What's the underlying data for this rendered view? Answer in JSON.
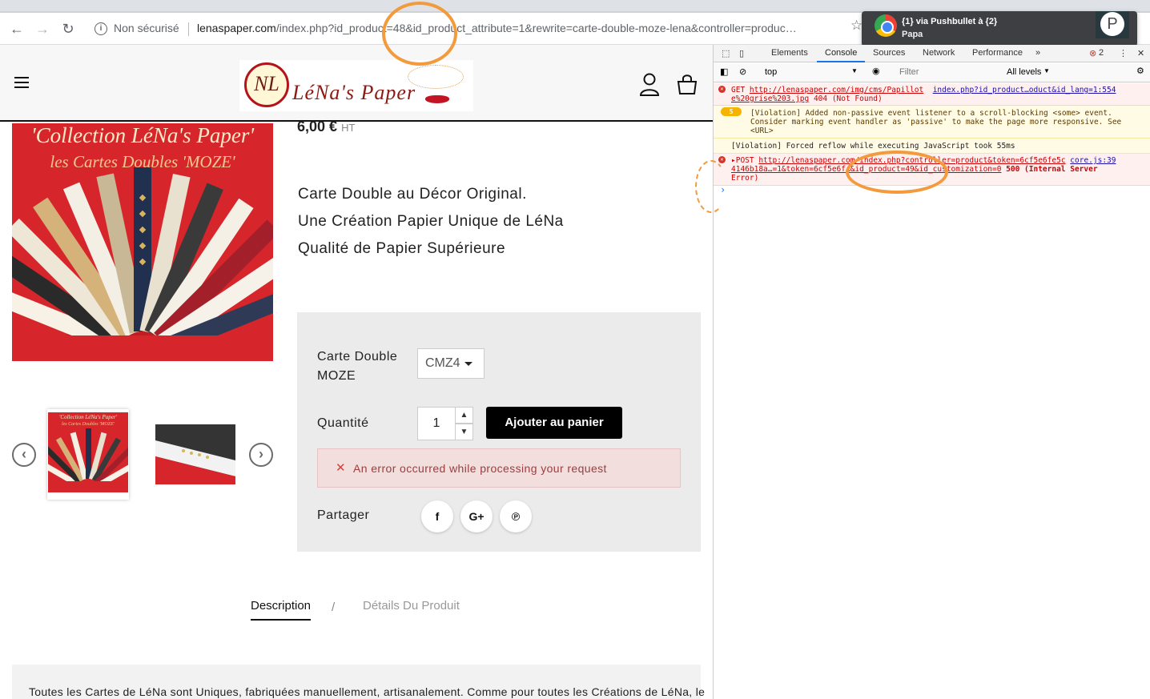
{
  "browser": {
    "security_label": "Non sécurisé",
    "url_host": "lenaspaper.com",
    "url_path": "/index.php?id_product=48&id_product_attribute=1&rewrite=carte-double-moze-lena&controller=produc…"
  },
  "notification": {
    "title": "{1} via Pushbullet à {2}",
    "subtitle": "Papa",
    "avatar_letter": "P"
  },
  "site": {
    "logo_text": "LéNa's Paper",
    "logo_initials": "NL"
  },
  "product": {
    "image_title_1": "'Collection LéNa's Paper'",
    "image_title_2": "les Cartes Doubles  'MOZE'",
    "thumb_title_1": "'Collection LéNa's Paper'",
    "thumb_title_2": "les Cartes Doubles 'MOZE'",
    "price": "6,00 €",
    "price_suffix": "HT",
    "description_lines": [
      "Carte Double au Décor Original.",
      "Une Création Papier Unique de LéNa",
      "Qualité de Papier Supérieure"
    ],
    "variant_label_1": "Carte Double",
    "variant_label_2": "MOZE",
    "variant_value": "CMZ4",
    "quantity_label": "Quantité",
    "quantity_value": "1",
    "add_to_cart": "Ajouter au panier",
    "error_message": "An error occurred while processing your request",
    "share_label": "Partager",
    "share_buttons": [
      "f",
      "G+",
      "℗"
    ]
  },
  "tabs": {
    "description": "Description",
    "separator": "/",
    "details": "Détails Du Produit"
  },
  "bottom_text": "Toutes les Cartes de LéNa sont Uniques, fabriquées manuellement, artisanalement. Comme pour toutes les Créations de LéNa, le",
  "devtools": {
    "tabs": [
      "Elements",
      "Console",
      "Sources",
      "Network",
      "Performance"
    ],
    "more": "»",
    "error_count": "2",
    "context": "top",
    "filter_placeholder": "Filter",
    "levels": "All levels",
    "messages": {
      "m1_line1_pre": "GET ",
      "m1_link": "http://lenaspaper.com/img/cms/Papillot",
      "m1_source": "index.php?id_product…oduct&id_lang=1:554",
      "m1_line2_link": "e%20grise%203.jpg",
      "m1_line2_status": " 404 (Not Found)",
      "m2_badge": "5",
      "m2_line1": "[Violation] Added non-passive event listener to a scroll-blocking <some> event.",
      "m2_line2": "Consider marking event handler as 'passive' to make the page more responsive. See",
      "m2_line3": "<URL>",
      "m3_line1": "[Violation] Forced reflow while executing JavaScript took 55ms",
      "m4_line1_pre": "▸POST ",
      "m4_link": "http://lenaspaper.com/index.php?controller=product&token=6cf5e6fe5c",
      "m4_source": "core.js:39",
      "m4_line2_link": "4146b18a…=1&token=6cf5e6f…&id_product=49&id_customization=0",
      "m4_line2_status": " 500 (Internal Server",
      "m4_line3": "Error)"
    },
    "prompt": "›"
  }
}
